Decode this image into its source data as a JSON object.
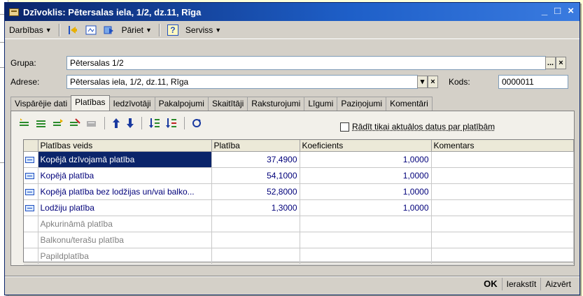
{
  "window": {
    "title": "Dzīvoklis: Pētersalas iela, 1/2, dz.11, Rīga",
    "controls": [
      "_",
      "□",
      "×"
    ]
  },
  "toolbar": {
    "actions_label": "Darbības",
    "goto_label": "Pāriet",
    "service_label": "Serviss",
    "help_icon": "?"
  },
  "form": {
    "group_label": "Grupa:",
    "group_value": "Pētersalas 1/2",
    "address_label": "Adrese:",
    "address_value": "Pētersalas iela, 1/2, dz.11, Rīga",
    "code_label": "Kods:",
    "code_value": "0000011",
    "ellipsis": "...",
    "clear": "×",
    "dropdown": "▾"
  },
  "tabs": [
    {
      "label": "Vispārējie dati"
    },
    {
      "label": "Platības",
      "active": true
    },
    {
      "label": "Iedzīvotāji"
    },
    {
      "label": "Pakalpojumi"
    },
    {
      "label": "Skaitītāji"
    },
    {
      "label": "Raksturojumi"
    },
    {
      "label": "Līgumi"
    },
    {
      "label": "Paziņojumi"
    },
    {
      "label": "Komentāri"
    }
  ],
  "panel": {
    "only_current_label": "Rādīt tikai aktuālos datus par platībām",
    "columns": [
      "Platības veids",
      "Platība",
      "Koeficients",
      "Komentars"
    ],
    "rows": [
      {
        "type": "Kopējā dzīvojamā platība",
        "area": "37,4900",
        "coef": "1,0000",
        "comment": "",
        "active": true,
        "selected": true
      },
      {
        "type": "Kopējā platība",
        "area": "54,1000",
        "coef": "1,0000",
        "comment": "",
        "active": true
      },
      {
        "type": "Kopējā platība bez lodžijas un/vai balko...",
        "area": "52,8000",
        "coef": "1,0000",
        "comment": "",
        "active": true
      },
      {
        "type": "Lodžiju platība",
        "area": "1,3000",
        "coef": "1,0000",
        "comment": "",
        "active": true
      },
      {
        "type": "Apkurināmā platība",
        "area": "",
        "coef": "",
        "comment": "",
        "active": false
      },
      {
        "type": "Balkonu/terašu platība",
        "area": "",
        "coef": "",
        "comment": "",
        "active": false
      },
      {
        "type": "Papildplatība",
        "area": "",
        "coef": "",
        "comment": "",
        "active": false
      }
    ]
  },
  "footer": {
    "ok_label": "OK",
    "save_label": "Ierakstīt",
    "close_label": "Aizvērt"
  },
  "colors": {
    "titlebar": "#0A246A",
    "selection": "#0A246A",
    "value_text": "#00007A"
  }
}
